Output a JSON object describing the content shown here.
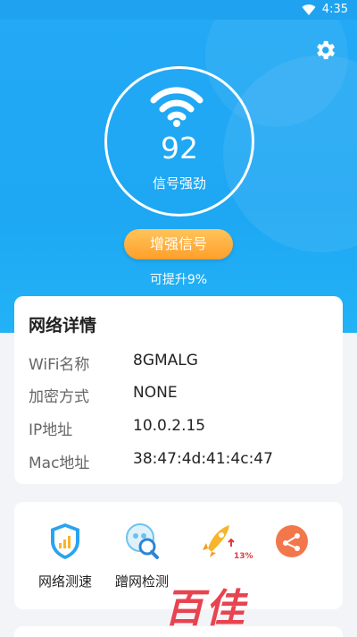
{
  "status_bar": {
    "time": "4:35"
  },
  "signal": {
    "value": "92",
    "label": "信号强劲"
  },
  "boost": {
    "button_label": "增强信号",
    "note": "可提升9%"
  },
  "details": {
    "title": "网络详情",
    "rows": [
      {
        "label": "WiFi名称",
        "value": "8GMALG"
      },
      {
        "label": "加密方式",
        "value": "NONE"
      },
      {
        "label": "IP地址",
        "value": "10.0.2.15"
      },
      {
        "label": "Mac地址",
        "value": "38:47:4d:41:4c:47"
      }
    ]
  },
  "tools": [
    {
      "label": "网络测速",
      "icon": "speed-test-shield-icon"
    },
    {
      "label": "蹭网检测",
      "icon": "freeloader-detect-icon"
    },
    {
      "label": "",
      "icon": "rocket-boost-icon",
      "badge": "13%"
    },
    {
      "label": "",
      "icon": "share-icon"
    }
  ],
  "watermark": "百佳",
  "colors": {
    "primary": "#1fa3f1",
    "accent": "#ff9f2b",
    "watermark": "#e8434f"
  }
}
